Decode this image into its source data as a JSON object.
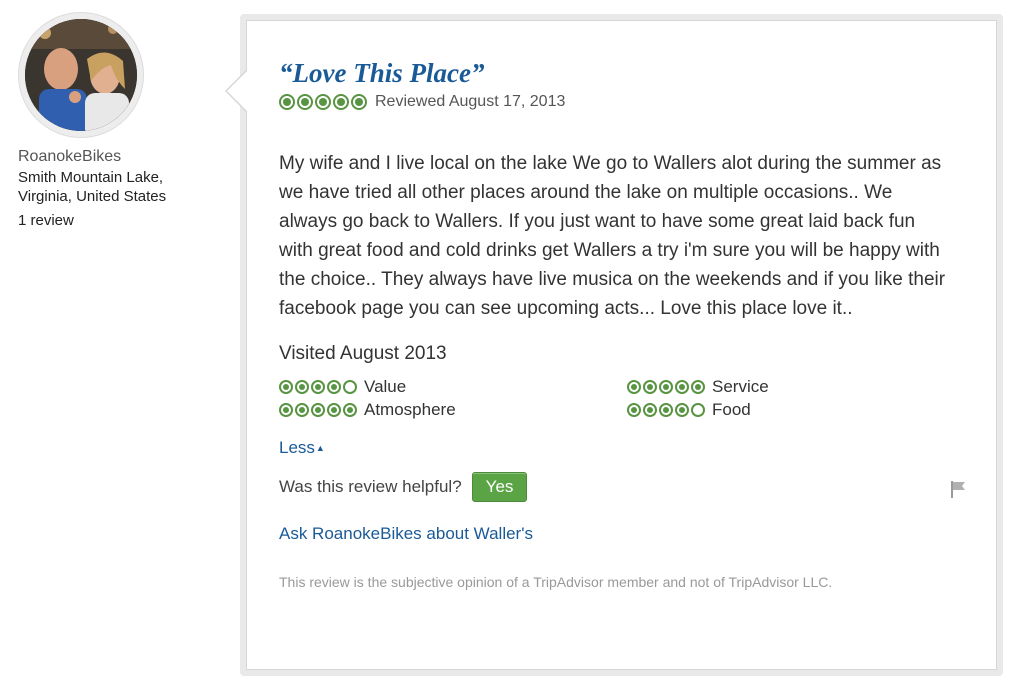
{
  "profile": {
    "username": "RoanokeBikes",
    "location": "Smith Mountain Lake, Virginia, United States",
    "review_count": "1 review"
  },
  "review": {
    "title": "“Love This Place”",
    "rating": 5,
    "reviewed_date": "Reviewed August 17, 2013",
    "body": "My wife and I live local on the lake We go to Wallers alot during the summer as we have tried all other places around the lake on multiple occasions.. We always go back to Wallers. If you just want to have some great laid back fun with great food and cold drinks get Wallers a try i'm sure you will be happy with the choice.. They always have live musica on the weekends and if you like their facebook page you can see upcoming acts... Love this place love it..",
    "visited": "Visited August 2013",
    "subratings": [
      {
        "label": "Value",
        "rating": 4
      },
      {
        "label": "Service",
        "rating": 5
      },
      {
        "label": "Atmosphere",
        "rating": 5
      },
      {
        "label": "Food",
        "rating": 4
      }
    ],
    "less_label": "Less",
    "helpful_question": "Was this review helpful?",
    "yes_label": "Yes",
    "ask_label": "Ask RoanokeBikes about Waller's",
    "disclaimer": "This review is the subjective opinion of a TripAdvisor member and not of TripAdvisor LLC."
  },
  "colors": {
    "bubble_green": "#589442",
    "link_blue": "#1a5a97",
    "button_green": "#5aa445"
  },
  "icons": {
    "rating_bubble": "rating-bubble-icon",
    "caret": "caret-up-icon",
    "flag": "flag-icon"
  }
}
